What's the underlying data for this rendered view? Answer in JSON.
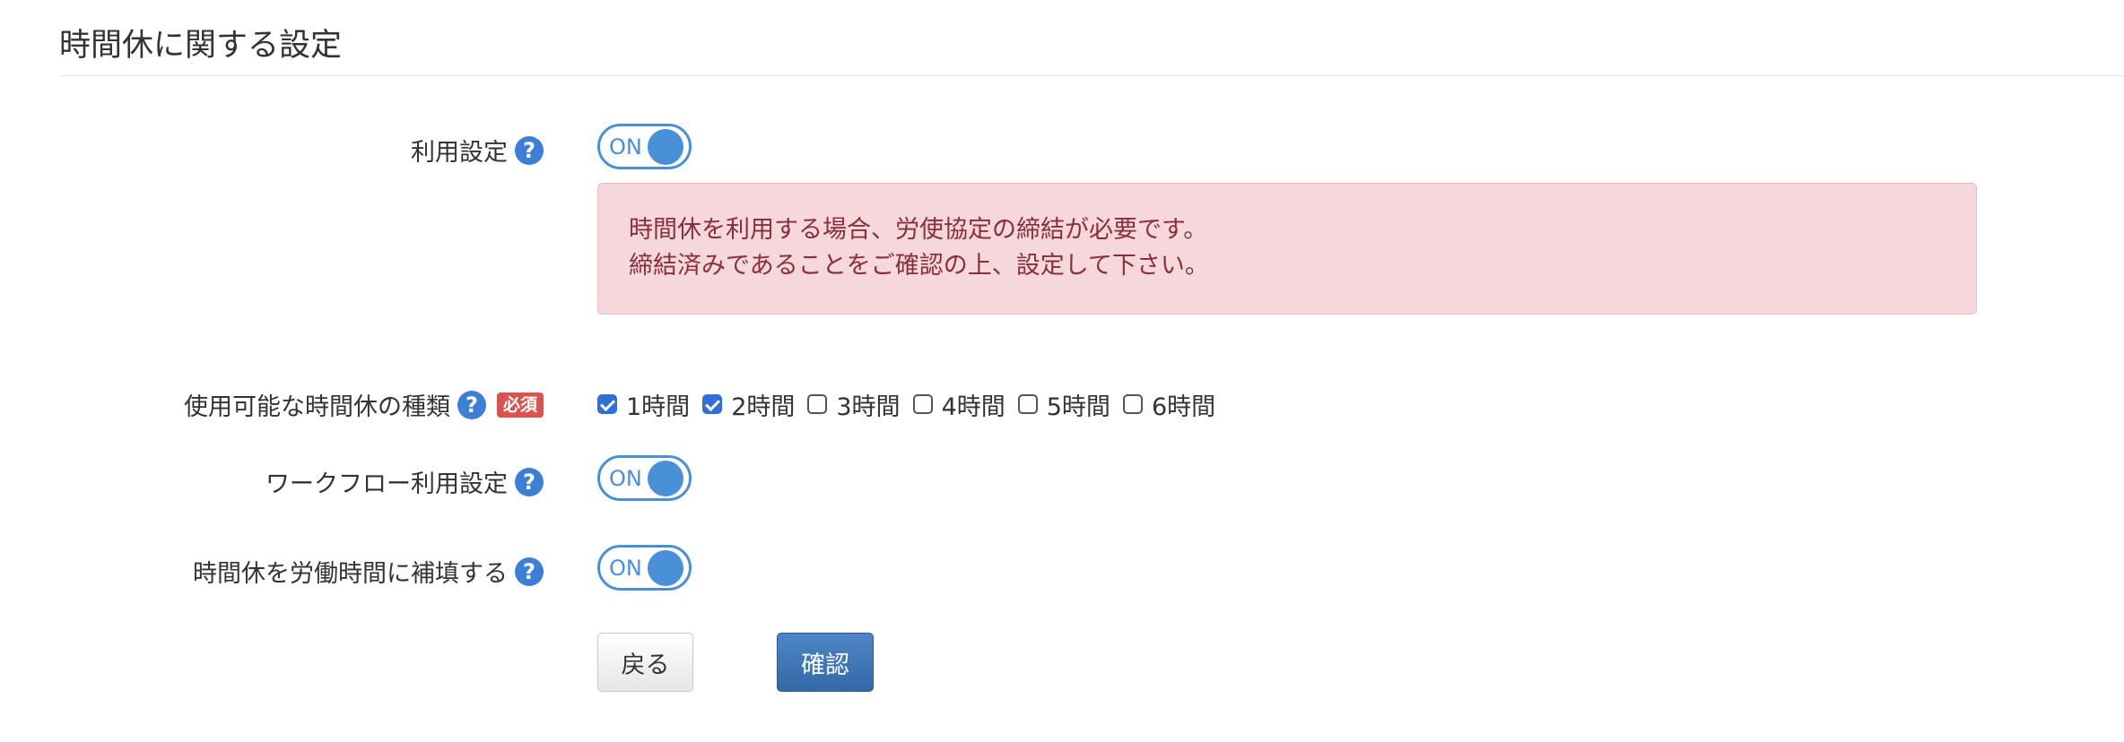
{
  "page": {
    "title": "時間休に関する設定"
  },
  "help_glyph": "?",
  "colors": {
    "accent": "#4a90d9",
    "alert_bg": "#f5d7dc",
    "alert_text": "#8a2f3a",
    "required": "#d9534f",
    "primary_button": "#3d75b5"
  },
  "settings": {
    "usage": {
      "label": "利用設定",
      "toggle": "ON",
      "enabled": true
    },
    "alert": {
      "line1": "時間休を利用する場合、労使協定の締結が必要です。",
      "line2": "締結済みであることをご確認の上、設定して下さい。"
    },
    "types": {
      "label": "使用可能な時間休の種類",
      "required_badge": "必須",
      "options": [
        {
          "label": "1時間",
          "checked": true
        },
        {
          "label": "2時間",
          "checked": true
        },
        {
          "label": "3時間",
          "checked": false
        },
        {
          "label": "4時間",
          "checked": false
        },
        {
          "label": "5時間",
          "checked": false
        },
        {
          "label": "6時間",
          "checked": false
        }
      ]
    },
    "workflow": {
      "label": "ワークフロー利用設定",
      "toggle": "ON",
      "enabled": true
    },
    "supplement": {
      "label": "時間休を労働時間に補填する",
      "toggle": "ON",
      "enabled": true
    }
  },
  "buttons": {
    "back": "戻る",
    "confirm": "確認"
  }
}
